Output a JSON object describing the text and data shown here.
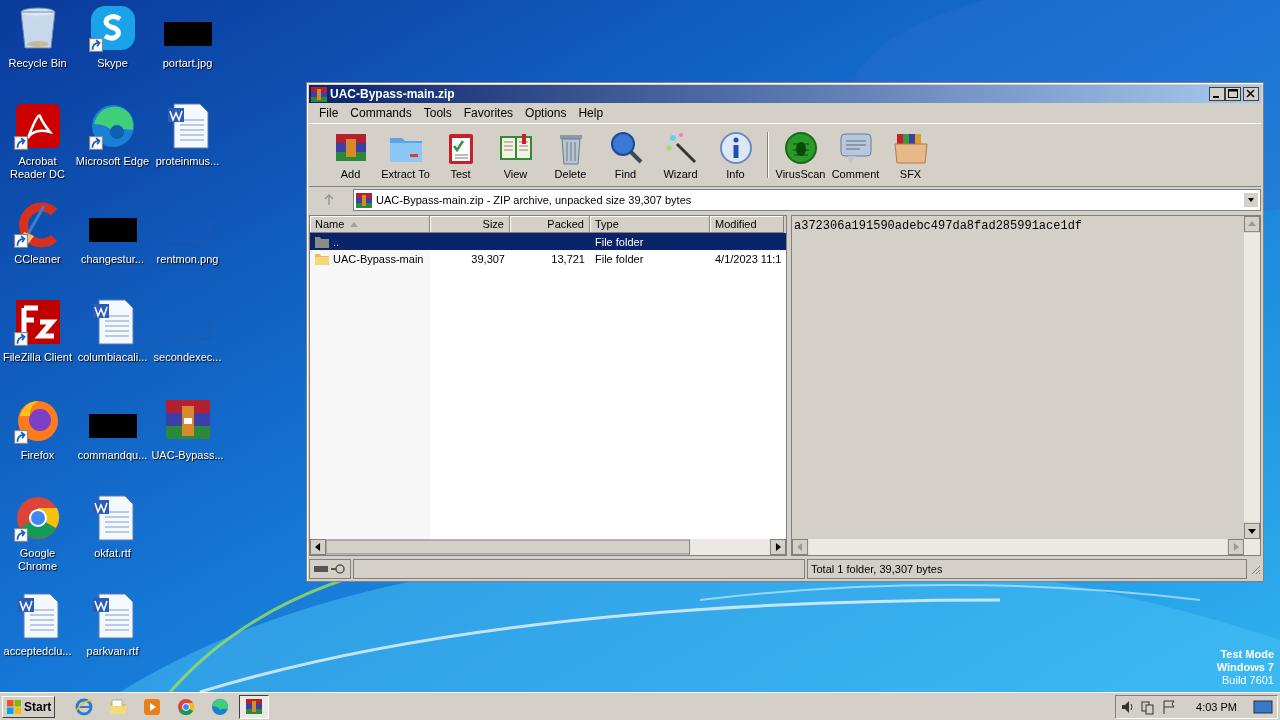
{
  "desktop": {
    "icon_rows": [
      [
        {
          "label": "Recycle Bin",
          "kind": "recycle",
          "shortcut": false
        },
        {
          "label": "Skype",
          "kind": "skype",
          "shortcut": true
        },
        {
          "label": "portart.jpg",
          "kind": "redacted",
          "shortcut": false
        }
      ],
      [
        {
          "label": "Acrobat Reader DC",
          "kind": "acrobat",
          "shortcut": true
        },
        {
          "label": "Microsoft Edge",
          "kind": "edge",
          "shortcut": true
        },
        {
          "label": "proteinmus...",
          "kind": "word",
          "shortcut": false
        }
      ],
      [
        {
          "label": "CCleaner",
          "kind": "ccleaner",
          "shortcut": true
        },
        {
          "label": "changestur...",
          "kind": "redacted",
          "shortcut": false
        },
        {
          "label": "rentmon.png",
          "kind": "blank",
          "shortcut": false
        }
      ],
      [
        {
          "label": "FileZilla Client",
          "kind": "filezilla",
          "shortcut": true
        },
        {
          "label": "columbiacali...",
          "kind": "word",
          "shortcut": false
        },
        {
          "label": "secondexec...",
          "kind": "blank",
          "shortcut": false
        }
      ],
      [
        {
          "label": "Firefox",
          "kind": "firefox",
          "shortcut": true
        },
        {
          "label": "commandqu...",
          "kind": "redacted",
          "shortcut": false
        },
        {
          "label": "UAC-Bypass...",
          "kind": "winrar",
          "shortcut": false
        }
      ],
      [
        {
          "label": "Google Chrome",
          "kind": "chrome",
          "shortcut": true
        },
        {
          "label": "okfat.rtf",
          "kind": "word",
          "shortcut": false
        }
      ],
      [
        {
          "label": "acceptedclu...",
          "kind": "word",
          "shortcut": false
        },
        {
          "label": "parkvan.rtf",
          "kind": "word",
          "shortcut": false
        }
      ]
    ]
  },
  "window": {
    "title": "UAC-Bypass-main.zip",
    "menu": [
      "File",
      "Commands",
      "Tools",
      "Favorites",
      "Options",
      "Help"
    ],
    "toolbar_groups": [
      [
        {
          "label": "Add",
          "kind": "add"
        },
        {
          "label": "Extract To",
          "kind": "extract"
        },
        {
          "label": "Test",
          "kind": "test"
        },
        {
          "label": "View",
          "kind": "view"
        },
        {
          "label": "Delete",
          "kind": "delete"
        },
        {
          "label": "Find",
          "kind": "find"
        },
        {
          "label": "Wizard",
          "kind": "wizard"
        },
        {
          "label": "Info",
          "kind": "info"
        }
      ],
      [
        {
          "label": "VirusScan",
          "kind": "virus"
        },
        {
          "label": "Comment",
          "kind": "comment"
        },
        {
          "label": "SFX",
          "kind": "sfx"
        }
      ]
    ],
    "address": "UAC-Bypass-main.zip - ZIP archive, unpacked size 39,307 bytes",
    "table": {
      "columns": [
        {
          "label": "Name",
          "sorted": true
        },
        {
          "label": "Size",
          "sorted": false
        },
        {
          "label": "Packed",
          "sorted": false
        },
        {
          "label": "Type",
          "sorted": false
        },
        {
          "label": "Modified",
          "sorted": false
        }
      ],
      "rows": [
        {
          "kind": "up",
          "selected": true,
          "cells": [
            "..",
            "",
            "",
            "File folder",
            ""
          ]
        },
        {
          "kind": "folder",
          "selected": false,
          "cells": [
            "UAC-Bypass-main",
            "39,307",
            "13,721",
            "File folder",
            "4/1/2023 11:1"
          ]
        }
      ]
    },
    "comment": "a372306a191590adebc497da8fad285991ace1df",
    "status": "Total 1 folder, 39,307 bytes"
  },
  "watermark_os": [
    "Test Mode",
    "Windows 7",
    "Build 7601"
  ],
  "taskbar": {
    "start": "Start",
    "apps": [
      {
        "kind": "ie",
        "selected": false
      },
      {
        "kind": "explorer",
        "selected": false
      },
      {
        "kind": "media",
        "selected": false
      },
      {
        "kind": "chrome",
        "selected": false
      },
      {
        "kind": "edge",
        "selected": false
      },
      {
        "kind": "winrar",
        "selected": true
      }
    ],
    "clock": "4:03 PM"
  }
}
